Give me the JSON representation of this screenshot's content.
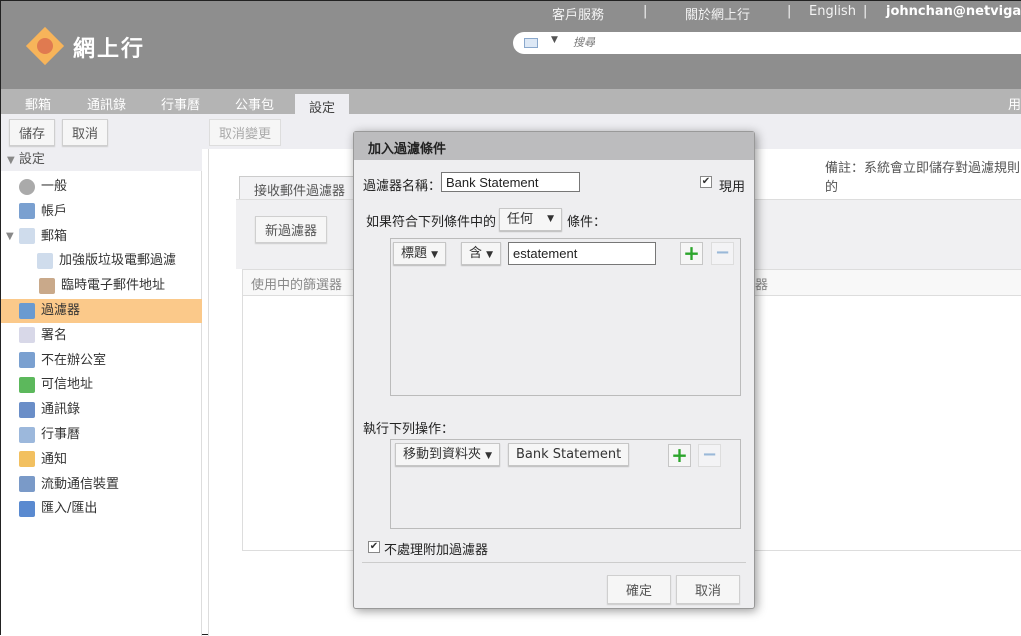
{
  "header": {
    "links": [
      "客戶服務",
      "|",
      "關於網上行",
      "|",
      "English",
      "|"
    ],
    "user": "johnchan@netvigato",
    "logo": "網上行",
    "search_placeholder": "搜尋",
    "accent": "#f7b45a"
  },
  "tabs": [
    "郵箱",
    "通訊錄",
    "行事曆",
    "公事包",
    "設定"
  ],
  "tabs_right": "用",
  "toolbar": {
    "save": "儲存",
    "cancel": "取消",
    "undo": "取消變更"
  },
  "sidebar": {
    "header": "設定",
    "items": [
      {
        "label": "一般",
        "icon": "gear-icon"
      },
      {
        "label": "帳戶",
        "icon": "account-icon"
      },
      {
        "label": "郵箱",
        "icon": "mail-icon"
      },
      {
        "label": "加強版垃圾電郵過濾",
        "icon": "mail-icon"
      },
      {
        "label": "臨時電子郵件地址",
        "icon": "trash-icon"
      },
      {
        "label": "過濾器",
        "icon": "filter-icon",
        "selected": true
      },
      {
        "label": "署名",
        "icon": "signature-icon"
      },
      {
        "label": "不在辦公室",
        "icon": "out-of-office-icon"
      },
      {
        "label": "可信地址",
        "icon": "shield-icon"
      },
      {
        "label": "通訊錄",
        "icon": "contact-icon"
      },
      {
        "label": "行事曆",
        "icon": "calendar-icon"
      },
      {
        "label": "通知",
        "icon": "bell-icon"
      },
      {
        "label": "流動通信裝置",
        "icon": "mobile-icon"
      },
      {
        "label": "匯入/匯出",
        "icon": "import-export-icon"
      }
    ]
  },
  "main": {
    "note": "備註：系統會立即儲存對過濾規則的",
    "tab": "接收郵件過濾器",
    "new_filter": "新過濾器",
    "col_header": "使用中的篩選器",
    "col_header2": "器"
  },
  "dialog": {
    "title": "加入過濾條件",
    "name_label": "過濾器名稱：",
    "name_value": "Bank Statement",
    "active_label": "現用",
    "active_checked": true,
    "cond_prefix": "如果符合下列條件中的",
    "cond_match": "任何",
    "cond_suffix": "條件：",
    "rule": {
      "field": "標題",
      "op": "含",
      "value": "estatement"
    },
    "action_label": "執行下列操作：",
    "action": {
      "type": "移動到資料夾",
      "folder": "Bank Statement"
    },
    "skip_label": "不處理附加過濾器",
    "skip_checked": true,
    "ok": "確定",
    "cancel": "取消"
  }
}
